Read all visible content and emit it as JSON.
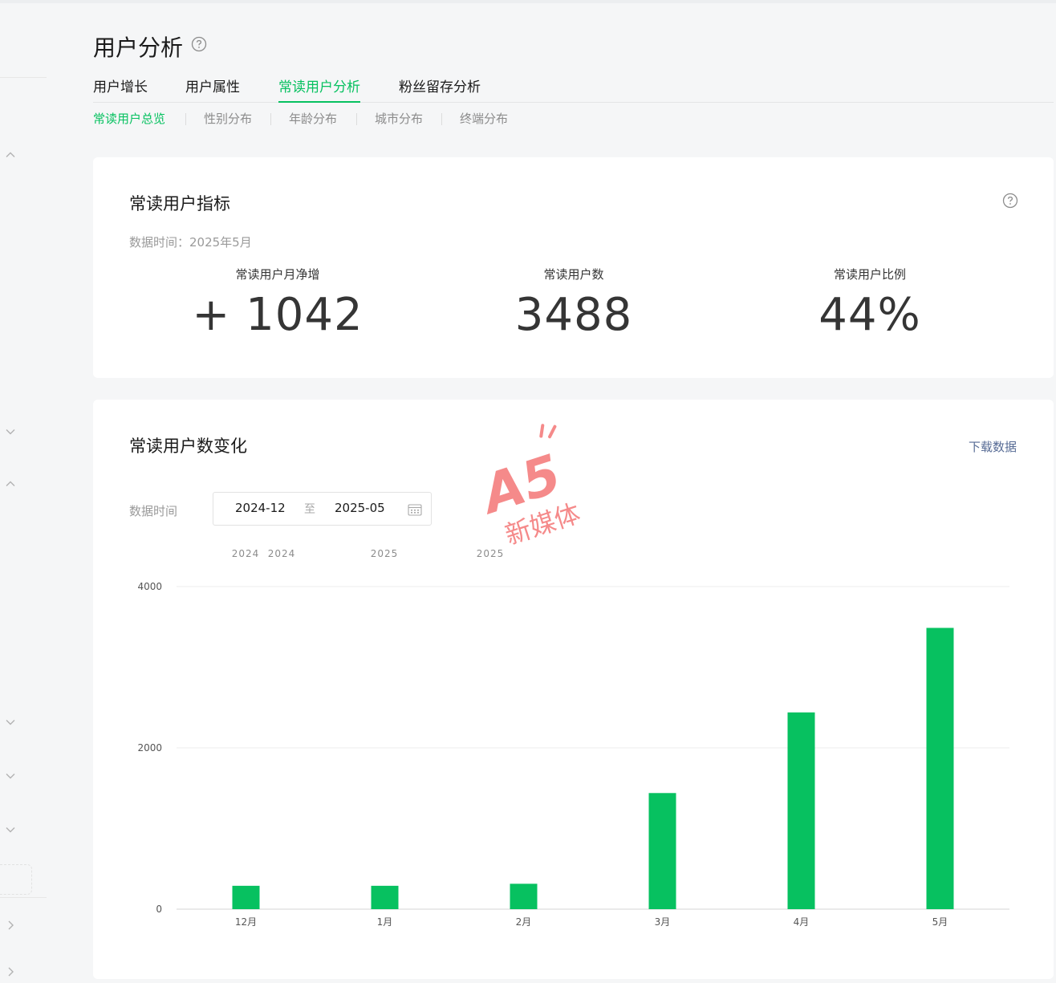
{
  "page": {
    "title": "用户分析"
  },
  "tabs": [
    {
      "label": "用户增长"
    },
    {
      "label": "用户属性"
    },
    {
      "label": "常读用户分析"
    },
    {
      "label": "粉丝留存分析"
    }
  ],
  "active_tab": "常读用户分析",
  "subtabs": [
    {
      "label": "常读用户总览"
    },
    {
      "label": "性别分布"
    },
    {
      "label": "年龄分布"
    },
    {
      "label": "城市分布"
    },
    {
      "label": "终端分布"
    }
  ],
  "active_subtab": "常读用户总览",
  "indicators": {
    "title": "常读用户指标",
    "data_time": "数据时间：2025年5月",
    "metrics": [
      {
        "label": "常读用户月净增",
        "value": "+ 1042"
      },
      {
        "label": "常读用户数",
        "value": "3488"
      },
      {
        "label": "常读用户比例",
        "value": "44%"
      }
    ]
  },
  "trend": {
    "title": "常读用户数变化",
    "download_label": "下载数据",
    "range_label": "数据时间",
    "range_start": "2024-12",
    "range_separator": "至",
    "range_end": "2025-05"
  },
  "watermark": {
    "mark": "A5",
    "text": "新媒体"
  },
  "colors": {
    "accent": "#07c160",
    "link": "#576b95",
    "watermark": "#f26d6d"
  },
  "icons": {
    "title_help": "question-circle-icon",
    "card_help": "question-circle-icon",
    "calendar": "calendar-icon",
    "sidebar_chevrons": [
      "chevron-up-icon",
      "chevron-down-icon",
      "chevron-up-icon",
      "chevron-down-icon",
      "chevron-down-icon",
      "chevron-down-icon",
      "chevron-right-icon",
      "chevron-right-icon"
    ]
  },
  "chart_data": {
    "type": "bar",
    "categories": [
      "12月",
      "1月",
      "2月",
      "3月",
      "4月",
      "5月"
    ],
    "year_labels": [
      "2024",
      "2024",
      "2025",
      "2025"
    ],
    "series": [
      {
        "values": [
          290,
          290,
          315,
          1440,
          2440,
          3488
        ]
      }
    ],
    "ylim": [
      0,
      4000
    ],
    "yticks": [
      0,
      2000,
      4000
    ],
    "grid": true,
    "color": "#07c160"
  }
}
